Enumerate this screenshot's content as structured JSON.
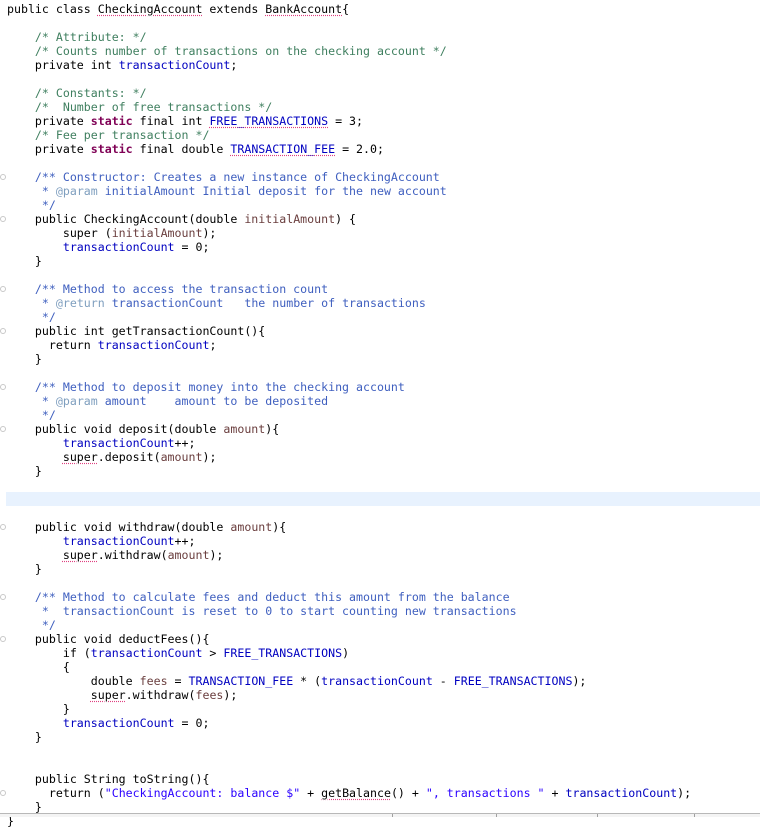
{
  "editor": {
    "language": "java",
    "current_line_index": 35,
    "lines": [
      [
        {
          "t": "public class ",
          "c": "kw"
        },
        {
          "t": "CheckingAccount",
          "c": "kw squiggle"
        },
        {
          "t": " extends ",
          "c": "kw"
        },
        {
          "t": "BankAccount",
          "c": "kw squiggle"
        },
        {
          "t": "{",
          "c": "kw"
        }
      ],
      [],
      [
        {
          "t": "    "
        },
        {
          "t": "/* Attribute: */",
          "c": "comment"
        }
      ],
      [
        {
          "t": "    "
        },
        {
          "t": "/* Counts number of transactions on the checking account */",
          "c": "comment"
        }
      ],
      [
        {
          "t": "    private int "
        },
        {
          "t": "transactionCount",
          "c": "field"
        },
        {
          "t": ";"
        }
      ],
      [],
      [
        {
          "t": "    "
        },
        {
          "t": "/* Constants: */",
          "c": "comment"
        }
      ],
      [
        {
          "t": "    "
        },
        {
          "t": "/*  Number of free transactions */",
          "c": "comment"
        }
      ],
      [
        {
          "t": "    private "
        },
        {
          "t": "static",
          "c": "kw-static"
        },
        {
          "t": " final int "
        },
        {
          "t": "FREE_TRANSACTIONS",
          "c": "const squiggle"
        },
        {
          "t": " = 3;"
        }
      ],
      [
        {
          "t": "    "
        },
        {
          "t": "/* Fee per transaction */",
          "c": "comment"
        }
      ],
      [
        {
          "t": "    private "
        },
        {
          "t": "static",
          "c": "kw-static"
        },
        {
          "t": " final double "
        },
        {
          "t": "TRANSACTION_FEE",
          "c": "const squiggle"
        },
        {
          "t": " = 2.0;"
        }
      ],
      [],
      [
        {
          "t": "    "
        },
        {
          "t": "/** Constructor: Creates a new instance of CheckingAccount",
          "c": "javadoc"
        }
      ],
      [
        {
          "t": "     "
        },
        {
          "t": "* ",
          "c": "javadoc"
        },
        {
          "t": "@param",
          "c": "jdtag"
        },
        {
          "t": " initialAmount Initial deposit for the new account",
          "c": "javadoc"
        }
      ],
      [
        {
          "t": "     "
        },
        {
          "t": "*/",
          "c": "javadoc"
        }
      ],
      [
        {
          "t": "    public CheckingAccount(double "
        },
        {
          "t": "initialAmount",
          "c": "param"
        },
        {
          "t": ") {"
        }
      ],
      [
        {
          "t": "        super ("
        },
        {
          "t": "initialAmount",
          "c": "param"
        },
        {
          "t": ");"
        }
      ],
      [
        {
          "t": "        "
        },
        {
          "t": "transactionCount",
          "c": "field"
        },
        {
          "t": " = 0;"
        }
      ],
      [
        {
          "t": "    }"
        }
      ],
      [],
      [
        {
          "t": "    "
        },
        {
          "t": "/** Method to access the transaction count",
          "c": "javadoc"
        }
      ],
      [
        {
          "t": "     "
        },
        {
          "t": "* ",
          "c": "javadoc"
        },
        {
          "t": "@return",
          "c": "jdtag"
        },
        {
          "t": " transactionCount   the number of transactions",
          "c": "javadoc"
        }
      ],
      [
        {
          "t": "     "
        },
        {
          "t": "*/",
          "c": "javadoc"
        }
      ],
      [
        {
          "t": "    public int getTransactionCount(){"
        }
      ],
      [
        {
          "t": "      return "
        },
        {
          "t": "transactionCount",
          "c": "field"
        },
        {
          "t": ";"
        }
      ],
      [
        {
          "t": "    }"
        }
      ],
      [],
      [
        {
          "t": "    "
        },
        {
          "t": "/** Method to deposit money into the checking account",
          "c": "javadoc"
        }
      ],
      [
        {
          "t": "     "
        },
        {
          "t": "* ",
          "c": "javadoc"
        },
        {
          "t": "@param",
          "c": "jdtag"
        },
        {
          "t": " amount    amount to be deposited",
          "c": "javadoc"
        }
      ],
      [
        {
          "t": "     "
        },
        {
          "t": "*/",
          "c": "javadoc"
        }
      ],
      [
        {
          "t": "    public void deposit(double "
        },
        {
          "t": "amount",
          "c": "param"
        },
        {
          "t": "){"
        }
      ],
      [
        {
          "t": "        "
        },
        {
          "t": "transactionCount",
          "c": "field"
        },
        {
          "t": "++;"
        }
      ],
      [
        {
          "t": "        "
        },
        {
          "t": "super",
          "c": "kw squiggle"
        },
        {
          "t": ".deposit("
        },
        {
          "t": "amount",
          "c": "param"
        },
        {
          "t": ");"
        }
      ],
      [
        {
          "t": "    }"
        }
      ],
      [],
      [],
      [],
      [
        {
          "t": "    public void withdraw(double "
        },
        {
          "t": "amount",
          "c": "param"
        },
        {
          "t": "){"
        }
      ],
      [
        {
          "t": "        "
        },
        {
          "t": "transactionCount",
          "c": "field"
        },
        {
          "t": "++;"
        }
      ],
      [
        {
          "t": "        "
        },
        {
          "t": "super",
          "c": "kw squiggle"
        },
        {
          "t": ".withdraw("
        },
        {
          "t": "amount",
          "c": "param"
        },
        {
          "t": ");"
        }
      ],
      [
        {
          "t": "    }"
        }
      ],
      [],
      [
        {
          "t": "    "
        },
        {
          "t": "/** Method to calculate fees and deduct this amount from the balance",
          "c": "javadoc"
        }
      ],
      [
        {
          "t": "     "
        },
        {
          "t": "*  transactionCount is reset to 0 to start counting new transactions",
          "c": "javadoc"
        }
      ],
      [
        {
          "t": "     "
        },
        {
          "t": "*/",
          "c": "javadoc"
        }
      ],
      [
        {
          "t": "    public void deductFees(){"
        }
      ],
      [
        {
          "t": "        if ("
        },
        {
          "t": "transactionCount",
          "c": "field"
        },
        {
          "t": " > "
        },
        {
          "t": "FREE_TRANSACTIONS",
          "c": "const"
        },
        {
          "t": ")"
        }
      ],
      [
        {
          "t": "        {"
        }
      ],
      [
        {
          "t": "            double "
        },
        {
          "t": "fees",
          "c": "param"
        },
        {
          "t": " = "
        },
        {
          "t": "TRANSACTION_FEE",
          "c": "const"
        },
        {
          "t": " * ("
        },
        {
          "t": "transactionCount",
          "c": "field"
        },
        {
          "t": " - "
        },
        {
          "t": "FREE_TRANSACTIONS",
          "c": "const"
        },
        {
          "t": ");"
        }
      ],
      [
        {
          "t": "            "
        },
        {
          "t": "super",
          "c": "kw squiggle"
        },
        {
          "t": ".withdraw("
        },
        {
          "t": "fees",
          "c": "param"
        },
        {
          "t": ");"
        }
      ],
      [
        {
          "t": "        }"
        }
      ],
      [
        {
          "t": "        "
        },
        {
          "t": "transactionCount",
          "c": "field"
        },
        {
          "t": " = 0;"
        }
      ],
      [
        {
          "t": "    }"
        }
      ],
      [],
      [],
      [
        {
          "t": "    public String toString(){"
        }
      ],
      [
        {
          "t": "      return ("
        },
        {
          "t": "\"CheckingAccount: balance $\"",
          "c": "str"
        },
        {
          "t": " + "
        },
        {
          "t": "getBalance",
          "c": "kw squiggle"
        },
        {
          "t": "() + "
        },
        {
          "t": "\", transactions \"",
          "c": "str"
        },
        {
          "t": " + "
        },
        {
          "t": "transactionCount",
          "c": "field"
        },
        {
          "t": ");"
        }
      ],
      [
        {
          "t": "    }"
        }
      ],
      [
        {
          "t": "}"
        }
      ]
    ],
    "fold_markers": [
      12,
      15,
      20,
      23,
      27,
      30,
      37,
      42,
      45,
      56
    ]
  }
}
